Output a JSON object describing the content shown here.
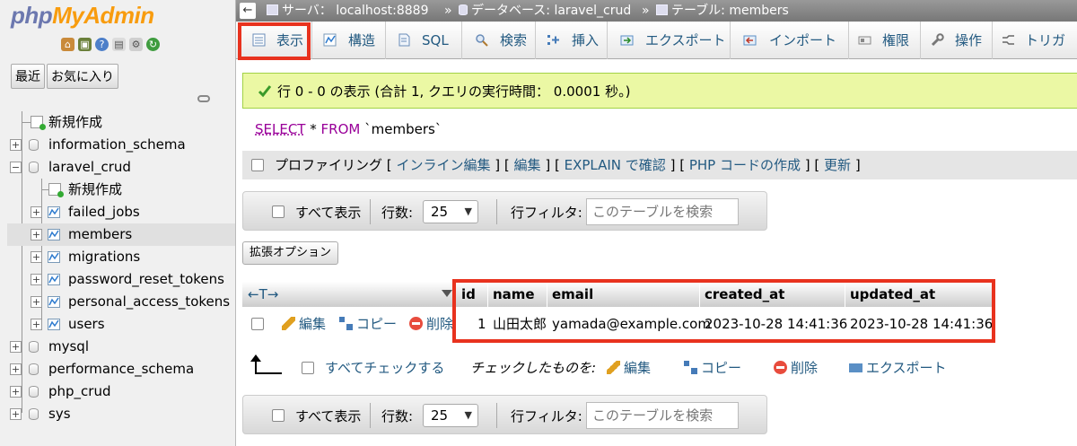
{
  "logo": {
    "part1": "php",
    "part2": "MyAdmin"
  },
  "left_buttons": {
    "recent": "最近",
    "favorites": "お気に入り"
  },
  "tree": {
    "new": "新規作成",
    "db_information_schema": "information_schema",
    "db_laravel_crud": "laravel_crud",
    "sub_new": "新規作成",
    "tables": [
      "failed_jobs",
      "members",
      "migrations",
      "password_reset_tokens",
      "personal_access_tokens",
      "users"
    ],
    "db_mysql": "mysql",
    "db_performance_schema": "performance_schema",
    "db_php_crud": "php_crud",
    "db_sys": "sys"
  },
  "breadcrumb": {
    "server": "サーバ： localhost:8889",
    "sep": "»",
    "database": "データベース: laravel_crud",
    "table": "テーブル: members"
  },
  "tabs": {
    "browse": "表示",
    "structure": "構造",
    "sql": "SQL",
    "search": "検索",
    "insert": "挿入",
    "export": "エクスポート",
    "import": "インポート",
    "privileges": "権限",
    "operations": "操作",
    "triggers": "トリガ"
  },
  "message": "行 0 - 0 の表示 (合計 1, クエリの実行時間： 0.0001 秒。)",
  "sql": {
    "select": "SELECT",
    "star": " * ",
    "from": "FROM",
    "table": " `members`"
  },
  "profiling": {
    "label": "プロファイリング",
    "lb": "[",
    "rb": "]",
    "inline_edit": "インライン編集",
    "edit": "編集",
    "explain": "EXPLAIN で確認",
    "php_code": "PHP コードの作成",
    "refresh": "更新"
  },
  "nav": {
    "show_all": "すべて表示",
    "rows_label": "行数:",
    "rows_value": "25",
    "filter_label": "行フィルタ:",
    "filter_placeholder": "このテーブルを検索"
  },
  "extended_options": "拡張オプション",
  "table": {
    "sorter": "←T→",
    "columns": [
      "id",
      "name",
      "email",
      "created_at",
      "updated_at"
    ],
    "rows": [
      {
        "id": "1",
        "name": "山田太郎",
        "email": "yamada@example.com",
        "created_at": "2023-10-28 14:41:36",
        "updated_at": "2023-10-28 14:41:36"
      }
    ],
    "row_actions": {
      "edit": "編集",
      "copy": "コピー",
      "delete": "削除"
    }
  },
  "bulk": {
    "check_all": "すべてチェックする",
    "with_selected": "チェックしたものを:",
    "edit": "編集",
    "copy": "コピー",
    "delete": "削除",
    "export": "エクスポート"
  },
  "colors": {
    "highlight": "#e8321e",
    "link": "#235a81",
    "success_bg": "#ebf8a4"
  }
}
